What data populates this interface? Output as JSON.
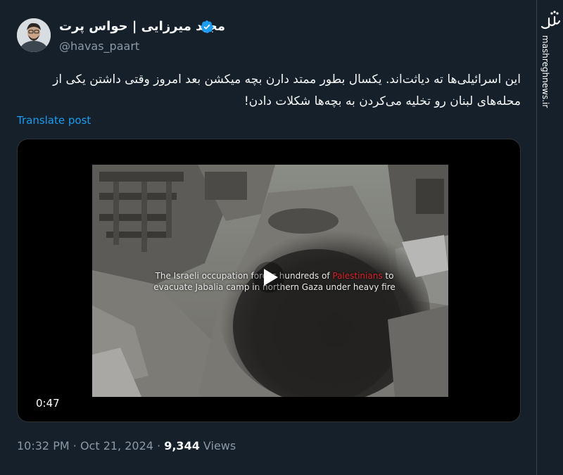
{
  "author": {
    "display_name": "مجید میرزایی | حواس پرت",
    "handle": "@havas_paart",
    "verified_color": "#1d9bf0"
  },
  "post": {
    "text": "این اسرائیلی‌ها ته دیاثت‌اند. یکسال بطور ممتد دارن بچه میکشن بعد امروز وقتی داشتن یکی از محله‌های لبنان رو تخلیه می‌کردن به بچه‌ها شکلات دادن!",
    "translate_label": "Translate post"
  },
  "video": {
    "duration": "0:47",
    "caption_prefix": "The Israeli occupation forces hundreds of",
    "caption_highlight": "Palestinians",
    "caption_suffix": "to evacuate Jabalia camp in northern Gaza under heavy fire"
  },
  "meta": {
    "time": "10:32 PM",
    "separator": "·",
    "date": "Oct 21, 2024",
    "views_count": "9,344",
    "views_label": "Views"
  },
  "watermark": {
    "logo_text": "مشرق",
    "site": "mashreghnews.ir"
  },
  "colors": {
    "background": "#15202b",
    "accent": "#1d9bf0",
    "secondary_text": "#8b98a5"
  }
}
